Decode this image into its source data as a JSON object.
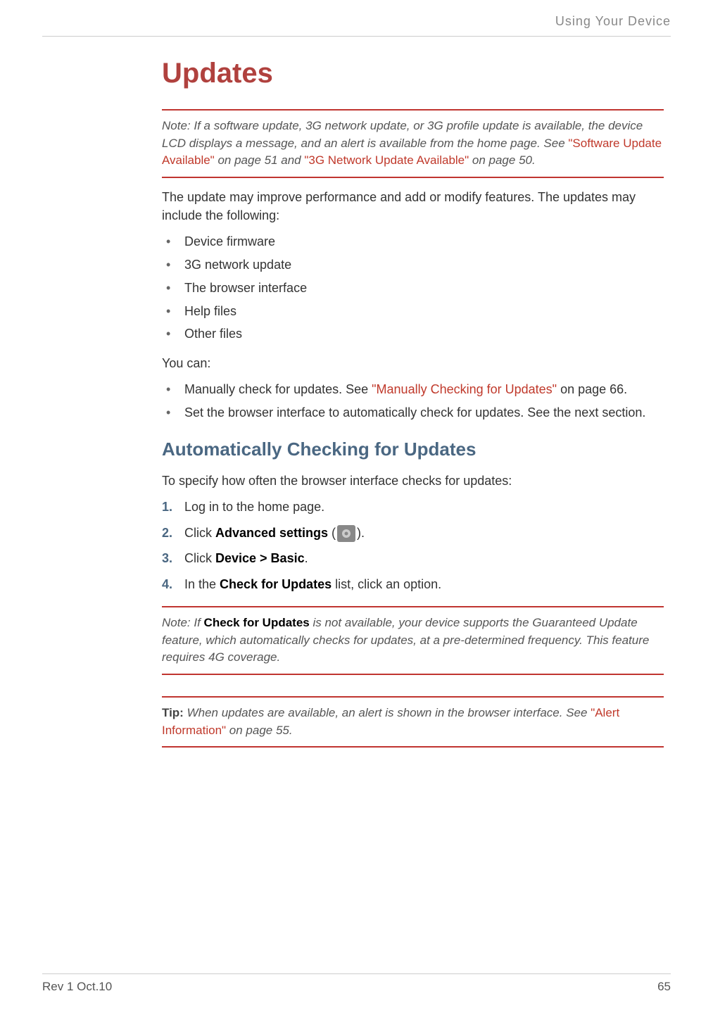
{
  "header": {
    "section_title": "Using Your Device"
  },
  "title": "Updates",
  "note1": {
    "label": "Note:",
    "part1": " If a software update, 3G network update, or 3G profile update is available, the device LCD displays a message, and an alert is available from the home page. See ",
    "link1": "\"Software Update Available\"",
    "part2": " on page 51 and ",
    "link2": "\"3G Network Update Available\"",
    "part3": " on page 50."
  },
  "intro_text": "The update may improve performance and add or modify features. The updates may include the following:",
  "update_list": [
    "Device firmware",
    "3G network update",
    "The browser interface",
    "Help files",
    "Other files"
  ],
  "you_can_text": "You can:",
  "you_can_list": {
    "item1_part1": "Manually check for updates. See ",
    "item1_link": "\"Manually Checking for Updates\"",
    "item1_part2": " on page 66.",
    "item2": "Set the browser interface to automatically check for updates. See the next section."
  },
  "subtitle": "Automatically Checking for Updates",
  "sub_intro": "To specify how often the browser interface checks for updates:",
  "steps": {
    "s1": "Log in to the home page.",
    "s2_part1": "Click ",
    "s2_bold": "Advanced settings",
    "s2_part2": " (",
    "s2_part3": ").",
    "s3_part1": "Click ",
    "s3_bold": "Device > Basic",
    "s3_part2": ".",
    "s4_part1": "In the ",
    "s4_bold": "Check for Updates",
    "s4_part2": " list, click an option."
  },
  "note2": {
    "label": "Note:",
    "part1": " If ",
    "bold": "Check  for Updates",
    "part2": " is not available, your device supports the Guaranteed Update feature, which automatically  checks  for updates, at a pre-determined frequency. This feature requires 4G coverage."
  },
  "tip": {
    "label": "Tip:",
    "part1": " When updates are available, an alert is shown in the browser interface. See ",
    "link": "\"Alert Information\"",
    "part2": " on page 55."
  },
  "footer": {
    "rev": "Rev 1  Oct.10",
    "page": "65"
  }
}
